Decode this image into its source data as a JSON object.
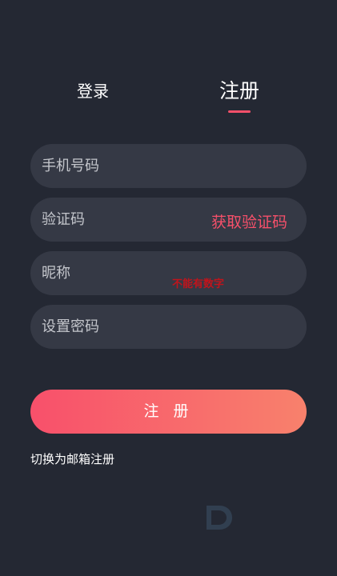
{
  "tabs": {
    "login_label": "登录",
    "register_label": "注册",
    "active_color": "#f7506a"
  },
  "form": {
    "phone_placeholder": "手机号码",
    "code_placeholder": "验证码",
    "get_code_label": "获取验证码",
    "nickname_placeholder": "昵称",
    "nickname_hint": "不能有数字",
    "password_placeholder": "设置密码",
    "submit_label": "注 册"
  },
  "footer": {
    "switch_email_label": "切换为邮箱注册"
  },
  "colors": {
    "background": "#242833",
    "field_background": "#353945",
    "accent": "#f7506a",
    "gradient_end": "#f8816c",
    "hint_red": "#c0141c"
  }
}
